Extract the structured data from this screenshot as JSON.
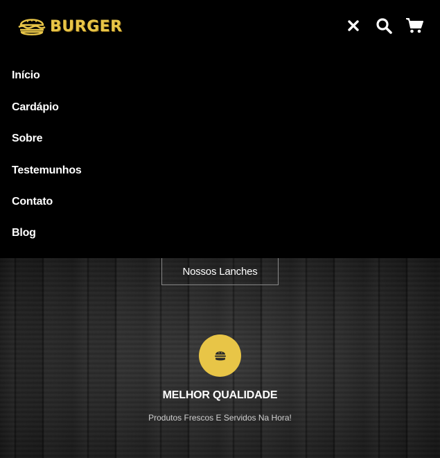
{
  "brand": {
    "name": "BURGER",
    "accent": "#e8c547"
  },
  "header": {
    "icons": [
      "close-icon",
      "search-icon",
      "cart-icon"
    ]
  },
  "menu": {
    "items": [
      {
        "label": "Início"
      },
      {
        "label": "Cardápio"
      },
      {
        "label": "Sobre"
      },
      {
        "label": "Testemunhos"
      },
      {
        "label": "Contato"
      },
      {
        "label": "Blog"
      }
    ]
  },
  "hero": {
    "cta_label": "Nossos Lanches"
  },
  "feature": {
    "icon": "burger-icon",
    "title": "MELHOR QUALIDADE",
    "description": "Produtos Frescos E Servidos Na Hora!"
  }
}
